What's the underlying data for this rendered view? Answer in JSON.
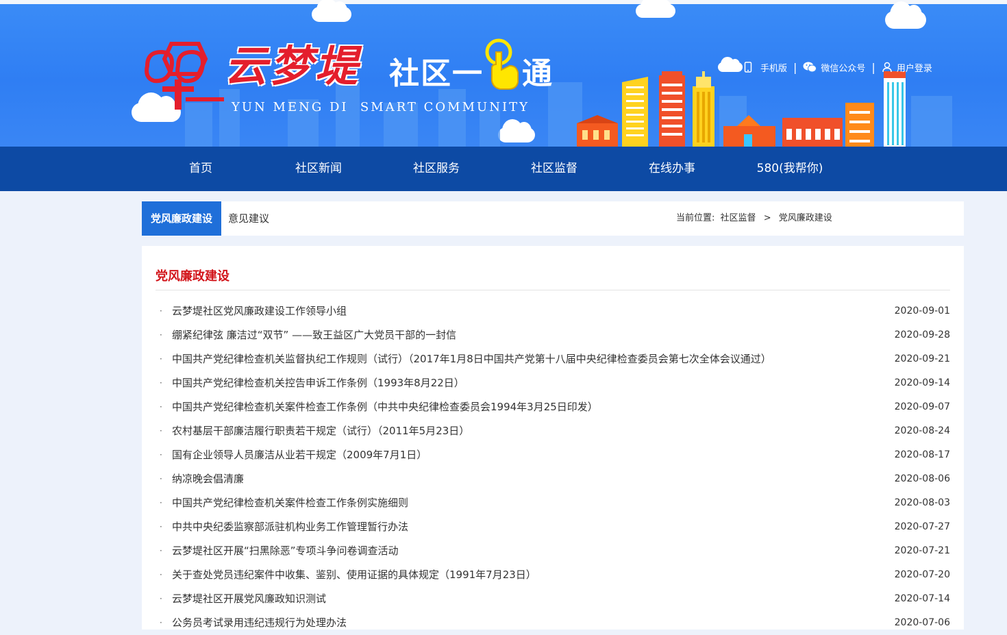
{
  "header": {
    "title_cn": "云梦堤",
    "title_suffix": "社区一",
    "title_suffix2": "通",
    "title_en": "YUN MENG DI  SMART COMMUNITY",
    "links": [
      {
        "label": "手机版"
      },
      {
        "label": "微信公众号"
      },
      {
        "label": "用户登录"
      }
    ],
    "separator": "|"
  },
  "nav": {
    "items": [
      {
        "label": "首页"
      },
      {
        "label": "社区新闻"
      },
      {
        "label": "社区服务"
      },
      {
        "label": "社区监督"
      },
      {
        "label": "在线办事"
      },
      {
        "label": "580(我帮你)"
      }
    ]
  },
  "subnav": {
    "tabs": [
      {
        "label": "党风廉政建设",
        "active": true
      },
      {
        "label": "意见建议",
        "active": false
      }
    ],
    "breadcrumb": {
      "prefix": "当前位置:",
      "items": [
        "社区监督",
        "党风廉政建设"
      ],
      "arrow": ">"
    }
  },
  "content": {
    "title": "党风廉政建设",
    "bullet": "·",
    "articles": [
      {
        "title": "云梦堤社区党风廉政建设工作领导小组",
        "date": "2020-09-01"
      },
      {
        "title": "绷紧纪律弦 廉洁过“双节” ——致王益区广大党员干部的一封信",
        "date": "2020-09-28"
      },
      {
        "title": "中国共产党纪律检查机关监督执纪工作规则（试行）（2017年1月8日中国共产党第十八届中央纪律检查委员会第七次全体会议通过）",
        "date": "2020-09-21"
      },
      {
        "title": "中国共产党纪律检查机关控告申诉工作条例（1993年8月22日）",
        "date": "2020-09-14"
      },
      {
        "title": "中国共产党纪律检查机关案件检查工作条例（中共中央纪律检查委员会1994年3月25日印发）",
        "date": "2020-09-07"
      },
      {
        "title": "农村基层干部廉洁履行职责若干规定（试行）（2011年5月23日）",
        "date": "2020-08-24"
      },
      {
        "title": "国有企业领导人员廉洁从业若干规定（2009年7月1日）",
        "date": "2020-08-17"
      },
      {
        "title": "纳凉晚会倡清廉",
        "date": "2020-08-06"
      },
      {
        "title": "中国共产党纪律检查机关案件检查工作条例实施细则",
        "date": "2020-08-03"
      },
      {
        "title": "中共中央纪委监察部派驻机构业务工作管理暂行办法",
        "date": "2020-07-27"
      },
      {
        "title": "云梦堤社区开展“扫黑除恶”专项斗争问卷调查活动",
        "date": "2020-07-21"
      },
      {
        "title": "关于查处党员违纪案件中收集、鉴别、使用证据的具体规定（1991年7月23日）",
        "date": "2020-07-20"
      },
      {
        "title": "云梦堤社区开展党风廉政知识测试",
        "date": "2020-07-14"
      },
      {
        "title": "公务员考试录用违纪违规行为处理办法",
        "date": "2020-07-06"
      }
    ]
  },
  "colors": {
    "banner": "#3b8cf7",
    "nav": "#0d4aa4",
    "active_tab": "#1f6fd9",
    "section_title": "#d2141a",
    "page_bg": "#edf2fb"
  }
}
